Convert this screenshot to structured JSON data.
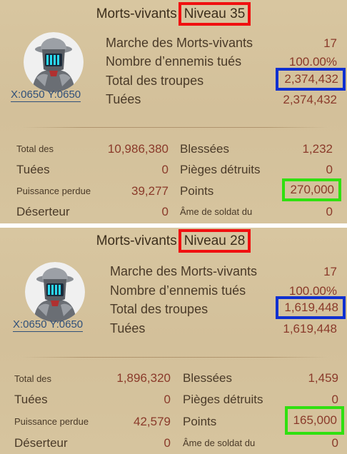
{
  "panels": [
    {
      "title": "Morts-vivants",
      "level": "Niveau 35",
      "coords": "X:0650 Y:0650",
      "info": [
        {
          "label": "Marche des Morts-vivants",
          "value": "17"
        },
        {
          "label": "Nombre d’ennemis tués",
          "value": "100.00%"
        },
        {
          "label": "Total des troupes",
          "value": "2,374,432"
        },
        {
          "label": "Tuées",
          "value": "2,374,432"
        }
      ],
      "stats_left": [
        {
          "label": "Total des",
          "value": "10,986,380"
        },
        {
          "label": "Tuées",
          "value": "0"
        },
        {
          "label": "Puissance perdue",
          "value": "39,277"
        },
        {
          "label": "Déserteur",
          "value": "0"
        }
      ],
      "stats_right": [
        {
          "label": "Blessées",
          "value": "1,232"
        },
        {
          "label": "Pièges détruits",
          "value": "0"
        },
        {
          "label": "Points",
          "value": "270,000"
        },
        {
          "label": "Âme de soldat du",
          "value": "0"
        }
      ]
    },
    {
      "title": "Morts-vivants",
      "level": "Niveau 28",
      "coords": "X:0650 Y:0650",
      "info": [
        {
          "label": "Marche des Morts-vivants",
          "value": "17"
        },
        {
          "label": "Nombre d’ennemis tués",
          "value": "100.00%"
        },
        {
          "label": "Total des troupes",
          "value": "1,619,448"
        },
        {
          "label": "Tuées",
          "value": "1,619,448"
        }
      ],
      "stats_left": [
        {
          "label": "Total des",
          "value": "1,896,320"
        },
        {
          "label": "Tuées",
          "value": "0"
        },
        {
          "label": "Puissance perdue",
          "value": "42,579"
        },
        {
          "label": "Déserteur",
          "value": "0"
        }
      ],
      "stats_right": [
        {
          "label": "Blessées",
          "value": "1,459"
        },
        {
          "label": "Pièges détruits",
          "value": "0"
        },
        {
          "label": "Points",
          "value": "165,000"
        },
        {
          "label": "Âme de soldat du",
          "value": "0"
        }
      ]
    }
  ],
  "colors": {
    "panel_bg": "#d6c49e",
    "value_text": "#8a3a2a",
    "highlight_level": "#f01010",
    "highlight_troops": "#1030d0",
    "highlight_points": "#30e010"
  }
}
